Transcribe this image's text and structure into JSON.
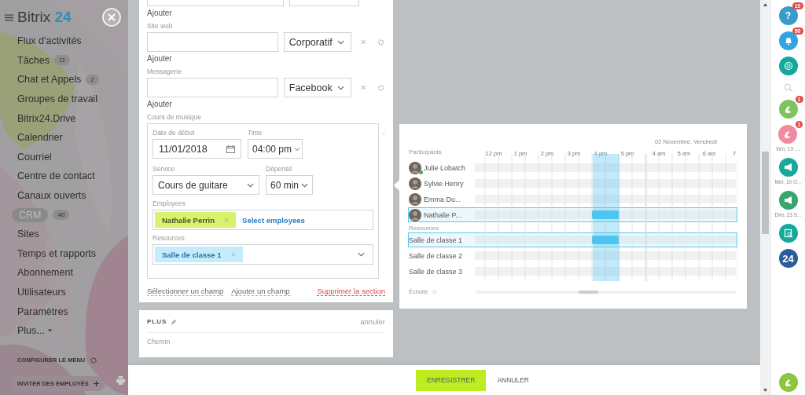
{
  "sidebar": {
    "brand": "Bitrix",
    "brand_suffix": "24",
    "menu": [
      {
        "label": "Flux d'activités",
        "selected": false
      },
      {
        "label": "Tâches",
        "counter": "11",
        "selected": false
      },
      {
        "label": "Chat et Appels",
        "counter": "2",
        "selected": false
      },
      {
        "label": "Groupes de travail",
        "selected": false
      },
      {
        "label": "Bitrix24.Drive",
        "selected": false
      },
      {
        "label": "Calendrier",
        "selected": false
      },
      {
        "label": "Courriel",
        "selected": false
      },
      {
        "label": "Centre de contact",
        "selected": false
      },
      {
        "label": "Canaux ouverts",
        "selected": false
      },
      {
        "label": "CRM",
        "counter": "40",
        "selected": true
      },
      {
        "label": "Sites",
        "selected": false
      },
      {
        "label": "Temps et rapports",
        "selected": false
      },
      {
        "label": "Abonnement",
        "selected": false
      },
      {
        "label": "Utilisateurs",
        "selected": false
      },
      {
        "label": "Paramètres",
        "selected": false
      },
      {
        "label": "Plus...",
        "selected": false
      }
    ],
    "configure": "CONFIGURER LE MENU",
    "invite": "INVITER DES EMPLOYÉS"
  },
  "form": {
    "top_add": "Ajouter",
    "fields": [
      {
        "label": "Site web",
        "type_value": "Corporatif",
        "add": "Ajouter"
      },
      {
        "label": "Messagerie",
        "type_value": "Facebook",
        "add": "Ajouter"
      }
    ],
    "booking": {
      "label": "Cours de musique",
      "date_label": "Date de début",
      "date": "11/01/2018",
      "time_label": "Time",
      "time": "04:00 pm",
      "service_label": "Service",
      "service": "Cours de guitare",
      "duration_label": "Dépensé",
      "duration": "60 min",
      "employees_label": "Employees",
      "employee_tag": "Nathalie Perrin",
      "select_employees": "Select employees",
      "resources_label": "Resources",
      "resource_tag": "Salle de classe 1"
    },
    "actions": {
      "select_field": "Sélectionner un champ",
      "add_field": "Ajouter un champ",
      "delete_section": "Supprimer la section"
    }
  },
  "plus_card": {
    "title": "PLUS",
    "cancel": "annuler",
    "field_label": "Chemin"
  },
  "footer": {
    "save": "ENREGISTRER",
    "cancel": "ANNULER"
  },
  "planner": {
    "participants_label": "Participants",
    "date_heading": "02 Novembre, Vendredi",
    "hours": [
      "12 pm",
      "1 pm",
      "2 pm",
      "3 pm",
      "4 pm",
      "5 pm"
    ],
    "hours_next": [
      "4 am",
      "5 am",
      "6 am",
      "7"
    ],
    "participants": [
      {
        "name": "Julie Lobatch",
        "online": true,
        "selected": false
      },
      {
        "name": "Sylvie Henry",
        "online": false,
        "selected": false
      },
      {
        "name": "Emma Du...",
        "online": false,
        "selected": false
      },
      {
        "name": "Nathalie P...",
        "online": false,
        "selected": true
      }
    ],
    "resources_label": "Resources",
    "resources": [
      {
        "name": "Salle de classe 1",
        "selected": true
      },
      {
        "name": "Salle de classe 2",
        "selected": false
      },
      {
        "name": "Salle de classe 3",
        "selected": false
      }
    ],
    "scale_label": "Échelle"
  },
  "right_bar": [
    {
      "kind": "help",
      "color": "#3a9bc8",
      "text": "?",
      "badge": "10"
    },
    {
      "kind": "bell",
      "color": "#2fa6e0",
      "badge": "50"
    },
    {
      "kind": "chat",
      "color": "#14a89a"
    },
    {
      "kind": "search"
    },
    {
      "kind": "phone",
      "color": "#7cc55e",
      "badge": "1"
    },
    {
      "kind": "phone",
      "color": "#f28aa0",
      "badge": "1",
      "caption": "Ven, 19 ...."
    },
    {
      "kind": "megaphone",
      "color": "#19a99b",
      "caption": "Mer, 10 O..."
    },
    {
      "kind": "megaphone",
      "color": "#3aa66e",
      "caption": "Dim, 23 S..."
    },
    {
      "kind": "document",
      "color": "#16a99b"
    },
    {
      "kind": "logo",
      "color": "#2b5c9e",
      "text": "24"
    }
  ],
  "call_button": {
    "color": "#8cc63f"
  }
}
